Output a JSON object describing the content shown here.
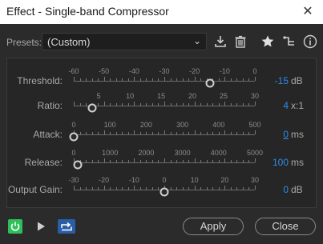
{
  "window": {
    "title": "Effect - Single-band Compressor"
  },
  "presets": {
    "label": "Presets:",
    "value": "(Custom)"
  },
  "icons": [
    "download-icon",
    "trash-icon",
    "star-icon",
    "route-icon",
    "info-icon"
  ],
  "params": [
    {
      "label": "Threshold:",
      "scale": [
        "-60",
        "-50",
        "-40",
        "-30",
        "-20",
        "-10",
        "0"
      ],
      "min": -60,
      "max": 0,
      "value": -15,
      "value_text": "-15",
      "unit": "dB"
    },
    {
      "label": "Ratio:",
      "scale": [
        "5",
        "10",
        "15",
        "20",
        "25",
        "30"
      ],
      "min": 1,
      "max": 30,
      "value": 4,
      "value_text": "4",
      "unit": "x:1"
    },
    {
      "label": "Attack:",
      "scale": [
        "0",
        "100",
        "200",
        "300",
        "400",
        "500"
      ],
      "min": 0,
      "max": 500,
      "value": 0,
      "value_text": "0",
      "unit": "ms"
    },
    {
      "label": "Release:",
      "scale": [
        "0",
        "1000",
        "2000",
        "3000",
        "4000",
        "5000"
      ],
      "min": 0,
      "max": 5000,
      "value": 100,
      "value_text": "100",
      "unit": "ms"
    },
    {
      "label": "Output Gain:",
      "scale": [
        "-30",
        "-20",
        "-10",
        "0",
        "10",
        "20",
        "30"
      ],
      "min": -30,
      "max": 30,
      "value": 0,
      "value_text": "0",
      "unit": "dB"
    }
  ],
  "buttons": {
    "apply": "Apply",
    "close": "Close"
  },
  "colors": {
    "accent": "#2d8ceb",
    "power": "#2fbf5a",
    "background": "#2b2b2b"
  }
}
